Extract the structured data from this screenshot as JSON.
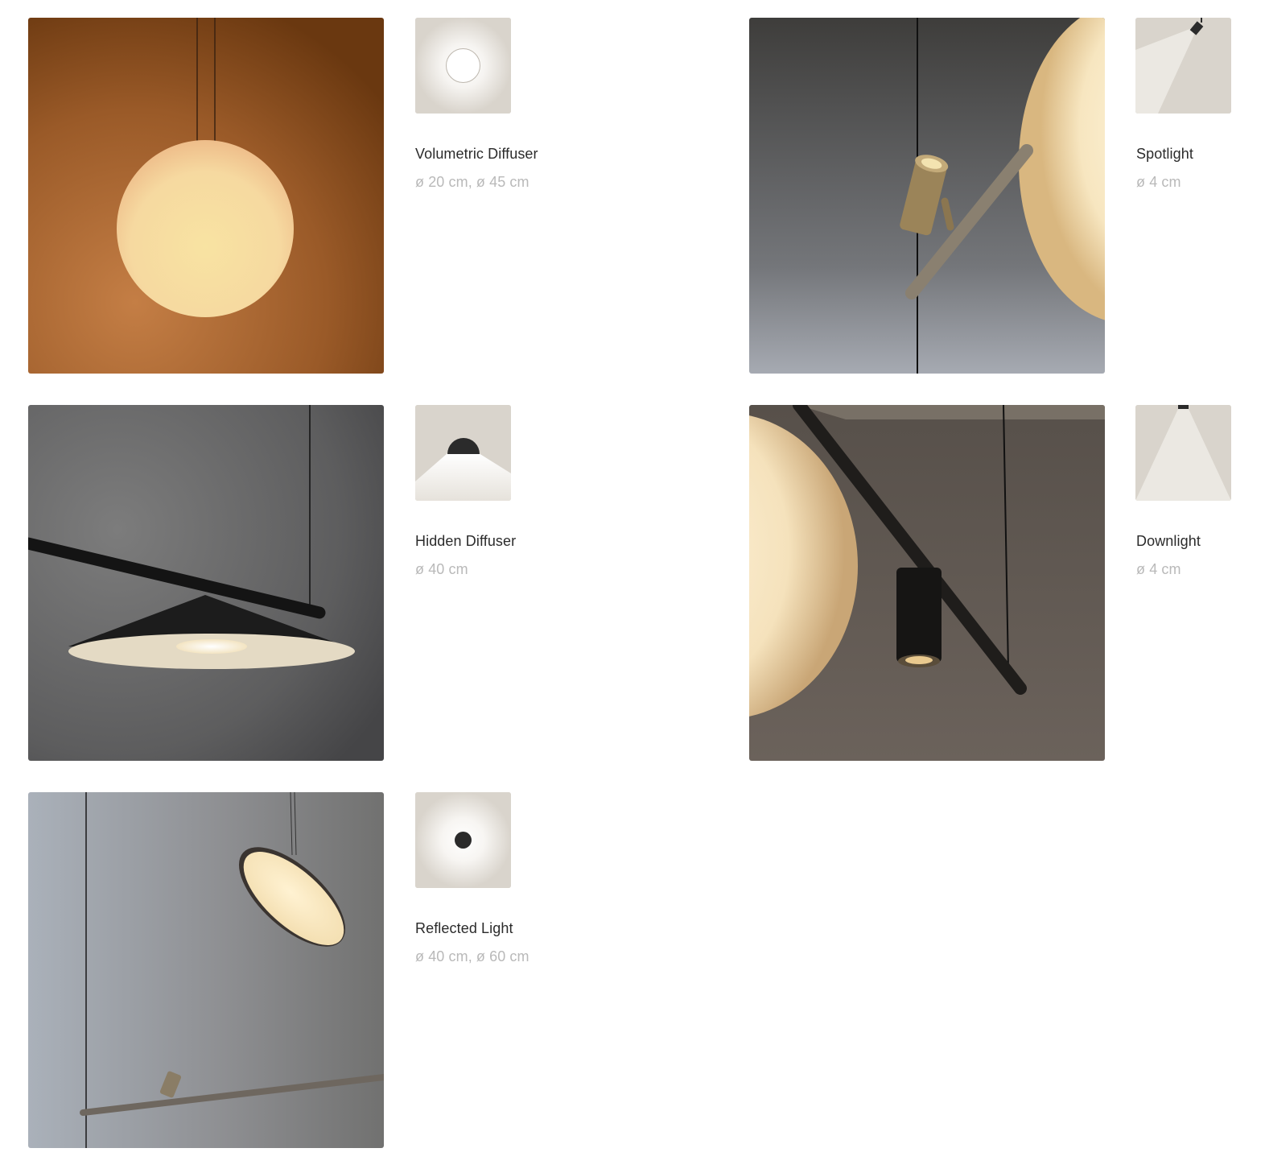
{
  "items": [
    {
      "name": "Volumetric Diffuser",
      "size": "ø 20 cm, ø 45 cm",
      "photo_icon": "globe-pendant-photo",
      "thumb_icon": "volumetric-diffuser-icon"
    },
    {
      "name": "Spotlight",
      "size": "ø 4 cm",
      "photo_icon": "spotlight-photo",
      "thumb_icon": "spotlight-icon"
    },
    {
      "name": "Hidden Diffuser",
      "size": "ø 40 cm",
      "photo_icon": "cone-shade-photo",
      "thumb_icon": "hidden-diffuser-icon"
    },
    {
      "name": "Downlight",
      "size": "ø 4 cm",
      "photo_icon": "downlight-photo",
      "thumb_icon": "downlight-icon"
    },
    {
      "name": "Reflected Light",
      "size": "ø 40 cm, ø 60 cm",
      "photo_icon": "reflector-disc-photo",
      "thumb_icon": "reflected-light-icon"
    }
  ],
  "colors": {
    "thumb_bg": "#d9d4cc",
    "name_text": "#2b2b2b",
    "size_text": "#b9b9b9"
  }
}
